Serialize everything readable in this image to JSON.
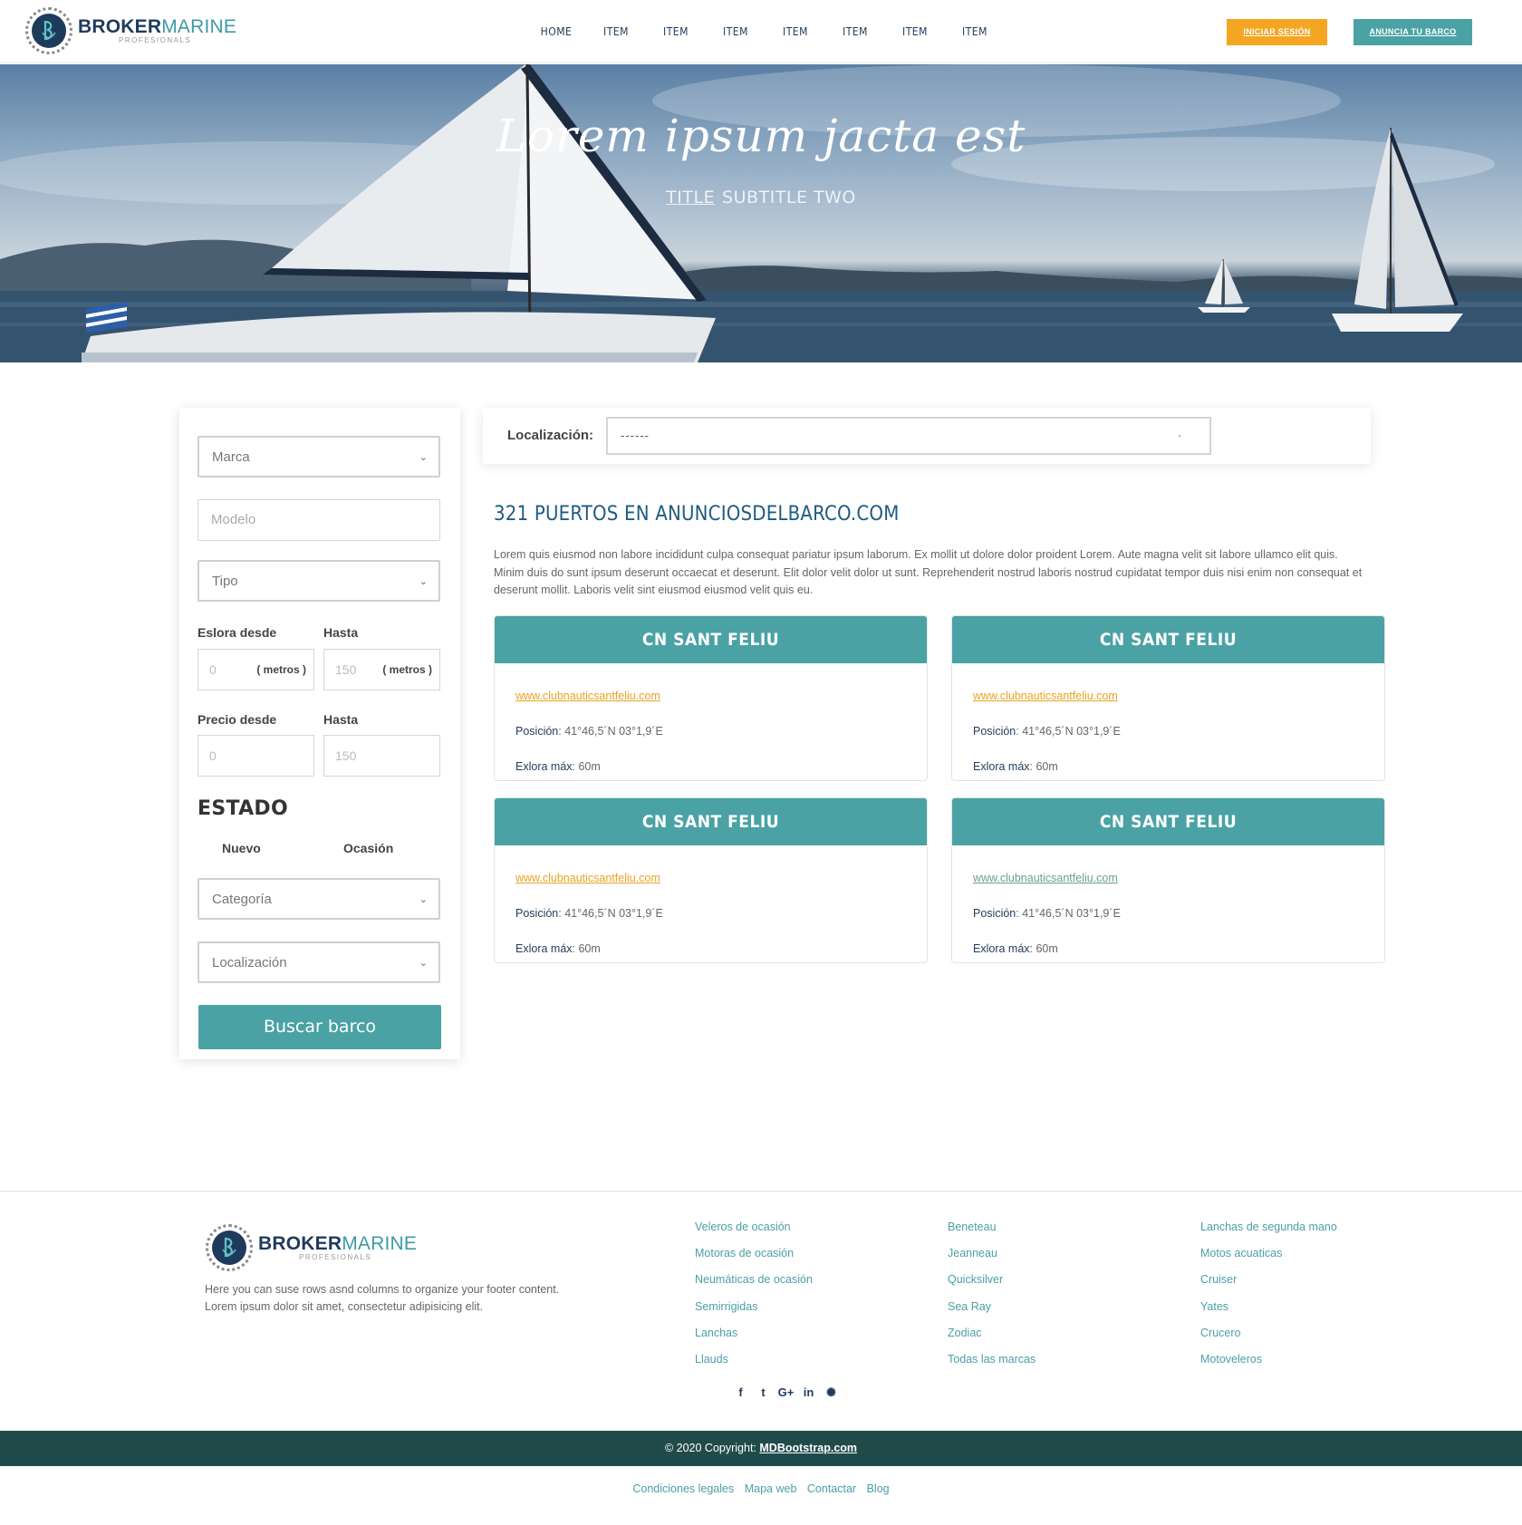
{
  "header": {
    "logo_brand_1": "BROKER",
    "logo_brand_2": "MARINE",
    "logo_sub": "PROFESIONALS",
    "nav": [
      "HOME",
      "ITEM",
      "ITEM",
      "ITEM",
      "ITEM",
      "ITEM",
      "ITEM",
      "ITEM"
    ],
    "login_label": "INICIAR SESIÓN",
    "anuncia_label": "ANUNCIA TU BARCO"
  },
  "hero": {
    "title": "Lorem ipsum jacta est",
    "subtitle_1": "TITLE",
    "subtitle_2": "SUBTITLE TWO"
  },
  "filters": {
    "marca": "Marca",
    "modelo_placeholder": "Modelo",
    "tipo": "Tipo",
    "eslora_desde_label": "Eslora desde",
    "eslora_hasta_label": "Hasta",
    "eslora_desde_value": "0",
    "eslora_hasta_value": "150",
    "unit": "( metros )",
    "precio_desde_label": "Precio desde",
    "precio_hasta_label": "Hasta",
    "precio_desde_value": "0",
    "precio_hasta_value": "150",
    "estado_title": "ESTADO",
    "nuevo_label": "Nuevo",
    "ocasion_label": "Ocasión",
    "categoria": "Categoría",
    "localizacion": "Localización",
    "search_label": "Buscar barco"
  },
  "location_bar": {
    "label": "Localización:",
    "value": "------",
    "caret": "-"
  },
  "main": {
    "title": "321 PUERTOS EN ANUNCIOSDELBARCO.COM",
    "description": "Lorem quis eiusmod non labore incididunt culpa consequat pariatur ipsum laborum. Ex mollit ut dolore dolor proident Lorem. Aute magna velit sit labore ullamco elit quis. Minim duis do sunt ipsum deserunt occaecat et deserunt. Elit dolor velit dolor ut sunt. Reprehenderit nostrud laboris nostrud cupidatat tempor duis nisi enim non consequat et deserunt mollit. Laboris velit sint eiusmod eiusmod velit quis eu.",
    "cards": [
      {
        "title": "CN SANT FELIU",
        "url": "www.clubnauticsantfeliu.com",
        "pos_label": "Posición",
        "pos_value": ": 41°46,5´N 03°1,9´E",
        "eslora_label": "Exlora máx",
        "eslora_value": ": 60m"
      },
      {
        "title": "CN SANT FELIU",
        "url": "www.clubnauticsantfeliu.com",
        "pos_label": "Posición",
        "pos_value": ": 41°46,5´N 03°1,9´E",
        "eslora_label": "Exlora máx",
        "eslora_value": ": 60m"
      },
      {
        "title": "CN SANT FELIU",
        "url": "www.clubnauticsantfeliu.com",
        "pos_label": "Posición",
        "pos_value": ": 41°46,5´N 03°1,9´E",
        "eslora_label": "Exlora máx",
        "eslora_value": ": 60m"
      },
      {
        "title": "CN SANT FELIU",
        "url": "www.clubnauticsantfeliu.com",
        "pos_label": "Posición",
        "pos_value": ": 41°46,5´N 03°1,9´E",
        "eslora_label": "Exlora máx",
        "eslora_value": ": 60m"
      }
    ]
  },
  "footer": {
    "description": "Here you can suse rows asnd columns to organize your footer content. Lorem ipsum dolor sit amet, consectetur adipisicing elit.",
    "col1": [
      "Veleros de ocasión",
      "Motoras de ocasión",
      "Neumáticas de ocasión",
      "Semirrigidas",
      "Lanchas",
      "Llauds"
    ],
    "col2": [
      "Beneteau",
      "Jeanneau",
      "Quicksilver",
      "Sea Ray",
      "Zodiac",
      "Todas las marcas"
    ],
    "col3": [
      "Lanchas de segunda mano",
      "Motos acuaticas",
      "Cruiser",
      "Yates",
      "Crucero",
      "Motoveleros"
    ],
    "social": [
      "f",
      "t",
      "G+",
      "in",
      "✺"
    ],
    "copyright": "© 2020 Copyright: ",
    "copyright_link": "MDBootstrap.com",
    "legal": [
      "Condiciones legales",
      "Mapa web",
      "Contactar",
      "Blog"
    ]
  },
  "colors": {
    "accent": "#4aa2a4",
    "orange": "#f4a522",
    "navy": "#1f3b5c",
    "footer_bar": "#214b4b"
  }
}
